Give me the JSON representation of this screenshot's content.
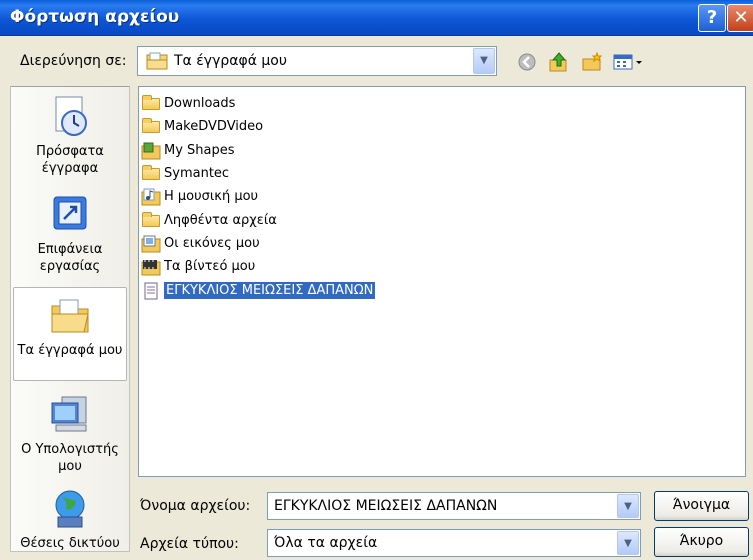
{
  "window": {
    "title": "Φόρτωση αρχείου",
    "help_label": "?",
    "close_label": "✕"
  },
  "look_in": {
    "label": "Διερεύνηση σε:",
    "value": "Τα έγγραφά μου"
  },
  "toolbar": {
    "back_icon": "back-icon",
    "up_icon": "up-folder-icon",
    "new_folder_icon": "new-folder-icon",
    "views_icon": "views-menu-icon"
  },
  "places": [
    {
      "label": "Πρόσφατα έγγραφα",
      "icon": "recent-documents-icon"
    },
    {
      "label": "Επιφάνεια εργασίας",
      "icon": "desktop-icon"
    },
    {
      "label": "Τα έγγραφά μου",
      "icon": "my-documents-icon"
    },
    {
      "label": "Ο Υπολογιστής μου",
      "icon": "my-computer-icon"
    },
    {
      "label": "Θέσεις δικτύου",
      "icon": "network-places-icon"
    }
  ],
  "files": [
    {
      "name": "Downloads",
      "icon": "folder-icon"
    },
    {
      "name": "MakeDVDVideo",
      "icon": "folder-icon"
    },
    {
      "name": "My Shapes",
      "icon": "shapes-folder-icon"
    },
    {
      "name": "Symantec",
      "icon": "folder-icon"
    },
    {
      "name": "Η μουσική μου",
      "icon": "music-folder-icon"
    },
    {
      "name": "Ληφθέντα αρχεία",
      "icon": "folder-icon"
    },
    {
      "name": "Οι εικόνες μου",
      "icon": "pictures-folder-icon"
    },
    {
      "name": "Τα βίντεό μου",
      "icon": "video-folder-icon"
    },
    {
      "name": "ΕΓΚΥΚΛΙΟΣ ΜΕΙΩΣΕΙΣ ΔΑΠΑΝΩΝ",
      "icon": "document-icon",
      "selected": true
    }
  ],
  "filename": {
    "label": "Όνομα αρχείου:",
    "value": "ΕΓΚΥΚΛΙΟΣ ΜΕΙΩΣΕΙΣ ΔΑΠΑΝΩΝ"
  },
  "filetype": {
    "label": "Αρχεία τύπου:",
    "value": "Όλα τα αρχεία"
  },
  "buttons": {
    "open": "Άνοιγμα",
    "cancel": "Άκυρο"
  },
  "colors": {
    "title_bar": "#0d57d6",
    "selection": "#316ac5",
    "dialog_bg": "#ece9d8"
  }
}
